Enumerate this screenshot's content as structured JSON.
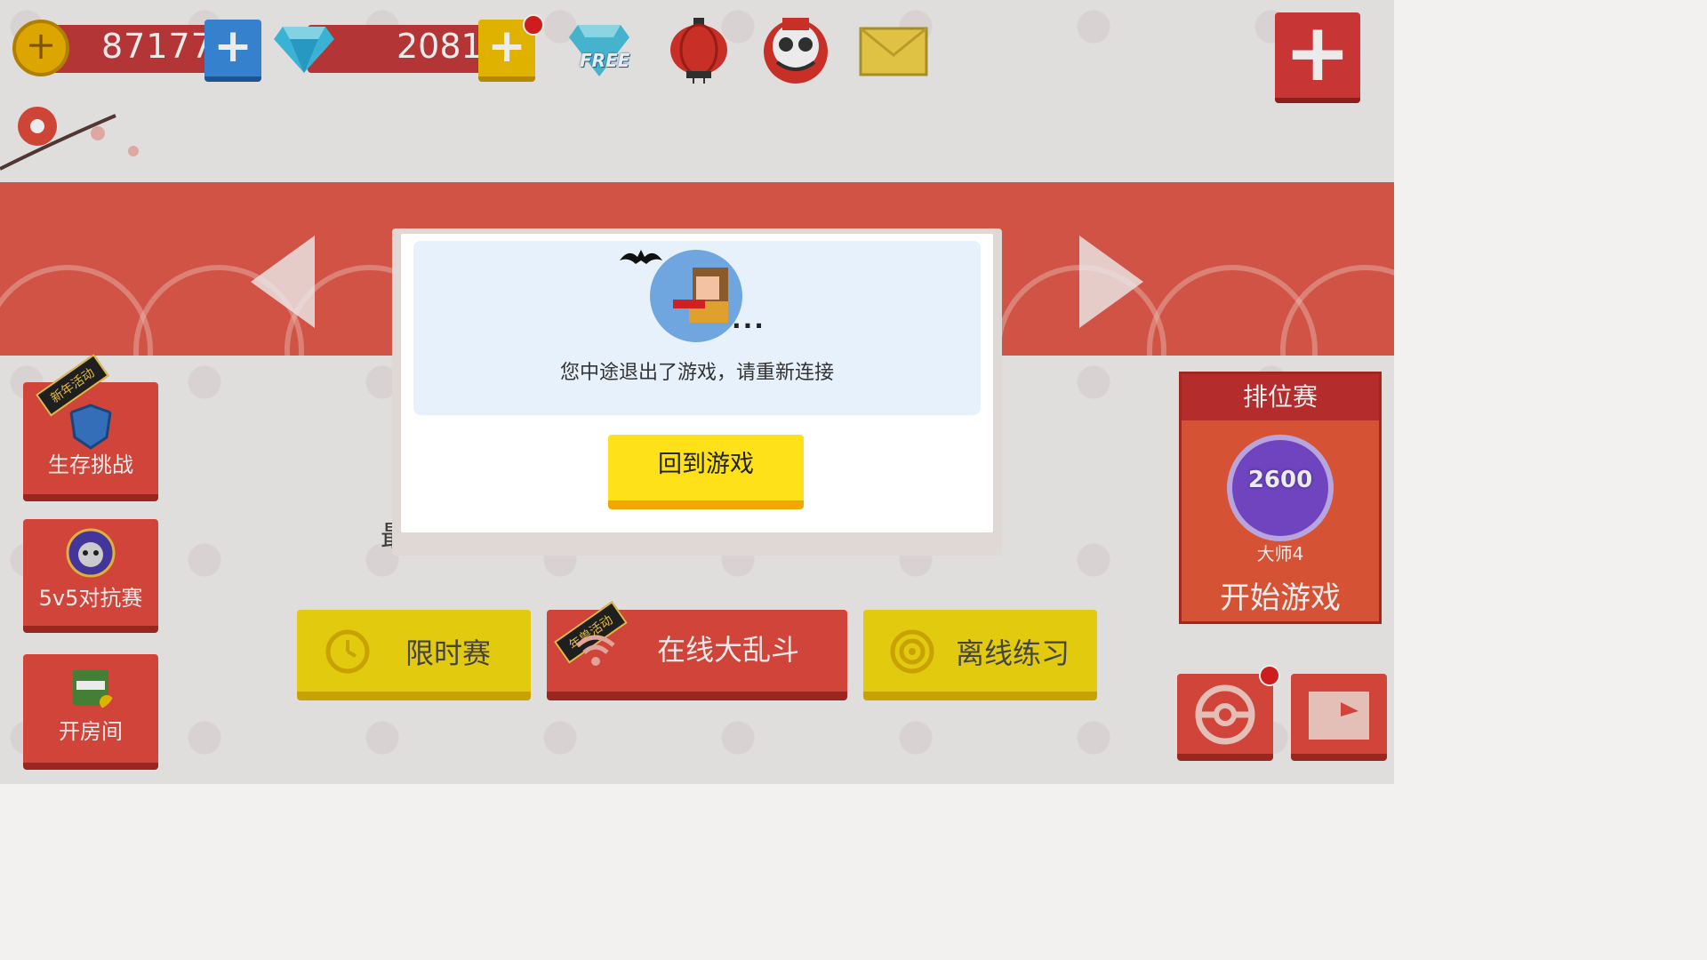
{
  "topbar": {
    "coins": "87177",
    "coin_glyph": "十",
    "gems": "2081",
    "free_label": "FREE",
    "plus": "+"
  },
  "banner": {},
  "side_buttons": [
    {
      "ribbon": "新年活动",
      "label": "生存挑战"
    },
    {
      "ribbon": "",
      "label": "5v5对抗赛"
    },
    {
      "ribbon": "",
      "label": "开房间"
    }
  ],
  "modes": [
    {
      "label": "限时赛",
      "ribbon": ""
    },
    {
      "label": "在线大乱斗",
      "ribbon": "年兽活动"
    },
    {
      "label": "离线练习",
      "ribbon": ""
    }
  ],
  "partial_text": "最",
  "ranking": {
    "title": "排位赛",
    "score": "2600",
    "level": "大师4",
    "start": "开始游戏"
  },
  "modal": {
    "dots": "...",
    "message": "您中途退出了游戏，请重新连接",
    "button": "回到游戏"
  },
  "colors": {
    "accent_red": "#e24a3e",
    "accent_yellow": "#ffe11a",
    "panel_blue": "#e6f1fb"
  }
}
